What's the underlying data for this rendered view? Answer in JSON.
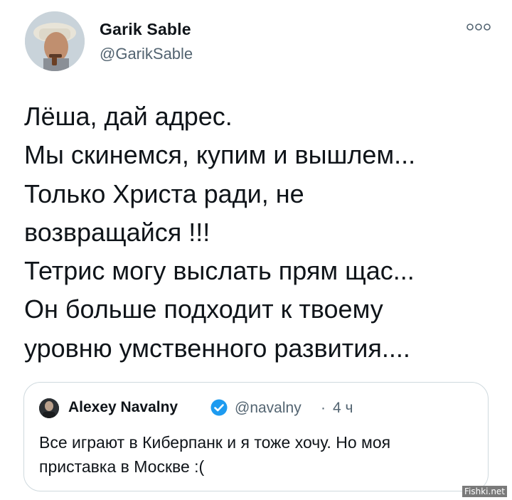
{
  "tweet": {
    "author_name": "Garik Sable",
    "author_handle": "@GarikSable",
    "more_icon": "more-dots-icon",
    "text_lines": [
      "Лёша, дай адрес.",
      "Мы скинемся, купим и вышлем...",
      "Только Христа ради, не",
      "возвращайся !!!",
      "Тетрис могу выслать прям щас...",
      "Он больше подходит к твоему",
      "уровню умственного развития...."
    ]
  },
  "quote": {
    "author_name": "Alexey Navalny",
    "verified_icon": "verified-badge-icon",
    "author_handle": "@navalny",
    "separator": "·",
    "time": "4 ч",
    "text_lines": [
      "Все играют в Киберпанк и я тоже хочу. Но моя",
      "приставка в Москве :("
    ]
  },
  "watermark": "Fishki.net",
  "colors": {
    "text": "#0f1419",
    "secondary": "#536471",
    "border": "#cfd9de",
    "verified": "#1d9bf0"
  }
}
